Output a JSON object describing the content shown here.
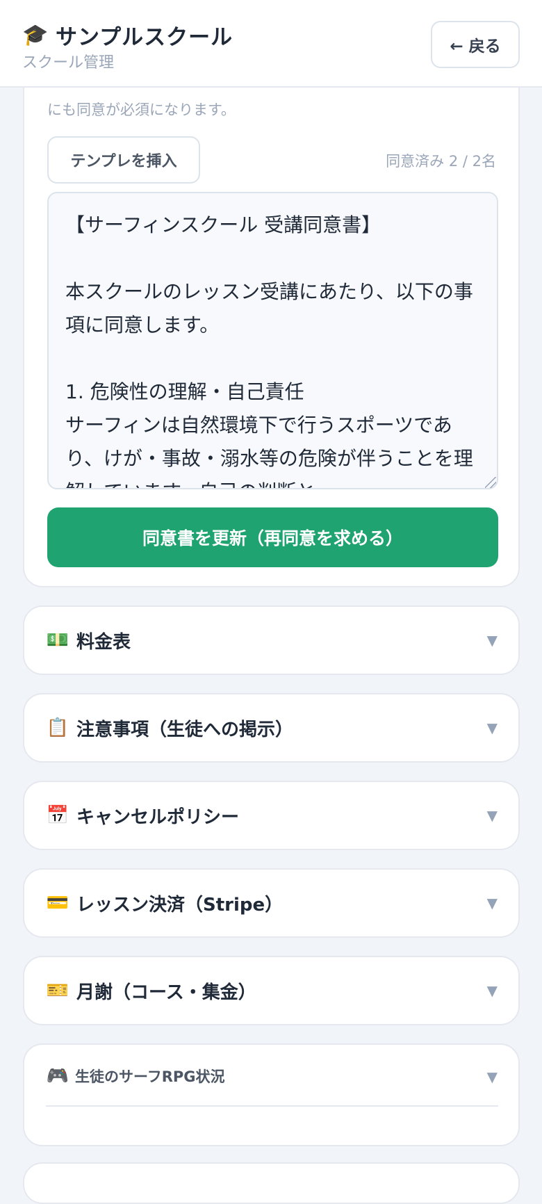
{
  "header": {
    "icon": "graduation-cap-icon",
    "title": "サンプルスクール",
    "subtitle": "スクール管理",
    "back_label": "← 戻る"
  },
  "consent": {
    "note": "にも同意が必須になります。",
    "template_button": "テンプレを挿入",
    "agreed_count": "同意済み 2 / 2名",
    "text": "【サーフィンスクール 受講同意書】\n\n本スクールのレッスン受講にあたり、以下の事項に同意します。\n\n1. 危険性の理解・自己責任\nサーフィンは自然環境下で行うスポーツであり、けが・事故・溺水等の危険が伴うことを理解しています。自己の判断と",
    "update_button": "同意書を更新（再同意を求める）"
  },
  "sections": [
    {
      "icon": "💵",
      "icon_name": "money-icon",
      "title": "料金表"
    },
    {
      "icon": "📋",
      "icon_name": "clipboard-icon",
      "title": "注意事項（生徒への掲示）"
    },
    {
      "icon": "📅",
      "icon_name": "calendar-icon",
      "title": "キャンセルポリシー"
    },
    {
      "icon": "💳",
      "icon_name": "credit-card-icon",
      "title": "レッスン決済（Stripe）"
    },
    {
      "icon": "🎫",
      "icon_name": "ticket-icon",
      "title": "月謝（コース・集金）"
    }
  ],
  "rpg": {
    "icon": "🎮",
    "icon_name": "game-controller-icon",
    "title": "生徒のサーフRPG状況"
  },
  "chevron": "▼"
}
